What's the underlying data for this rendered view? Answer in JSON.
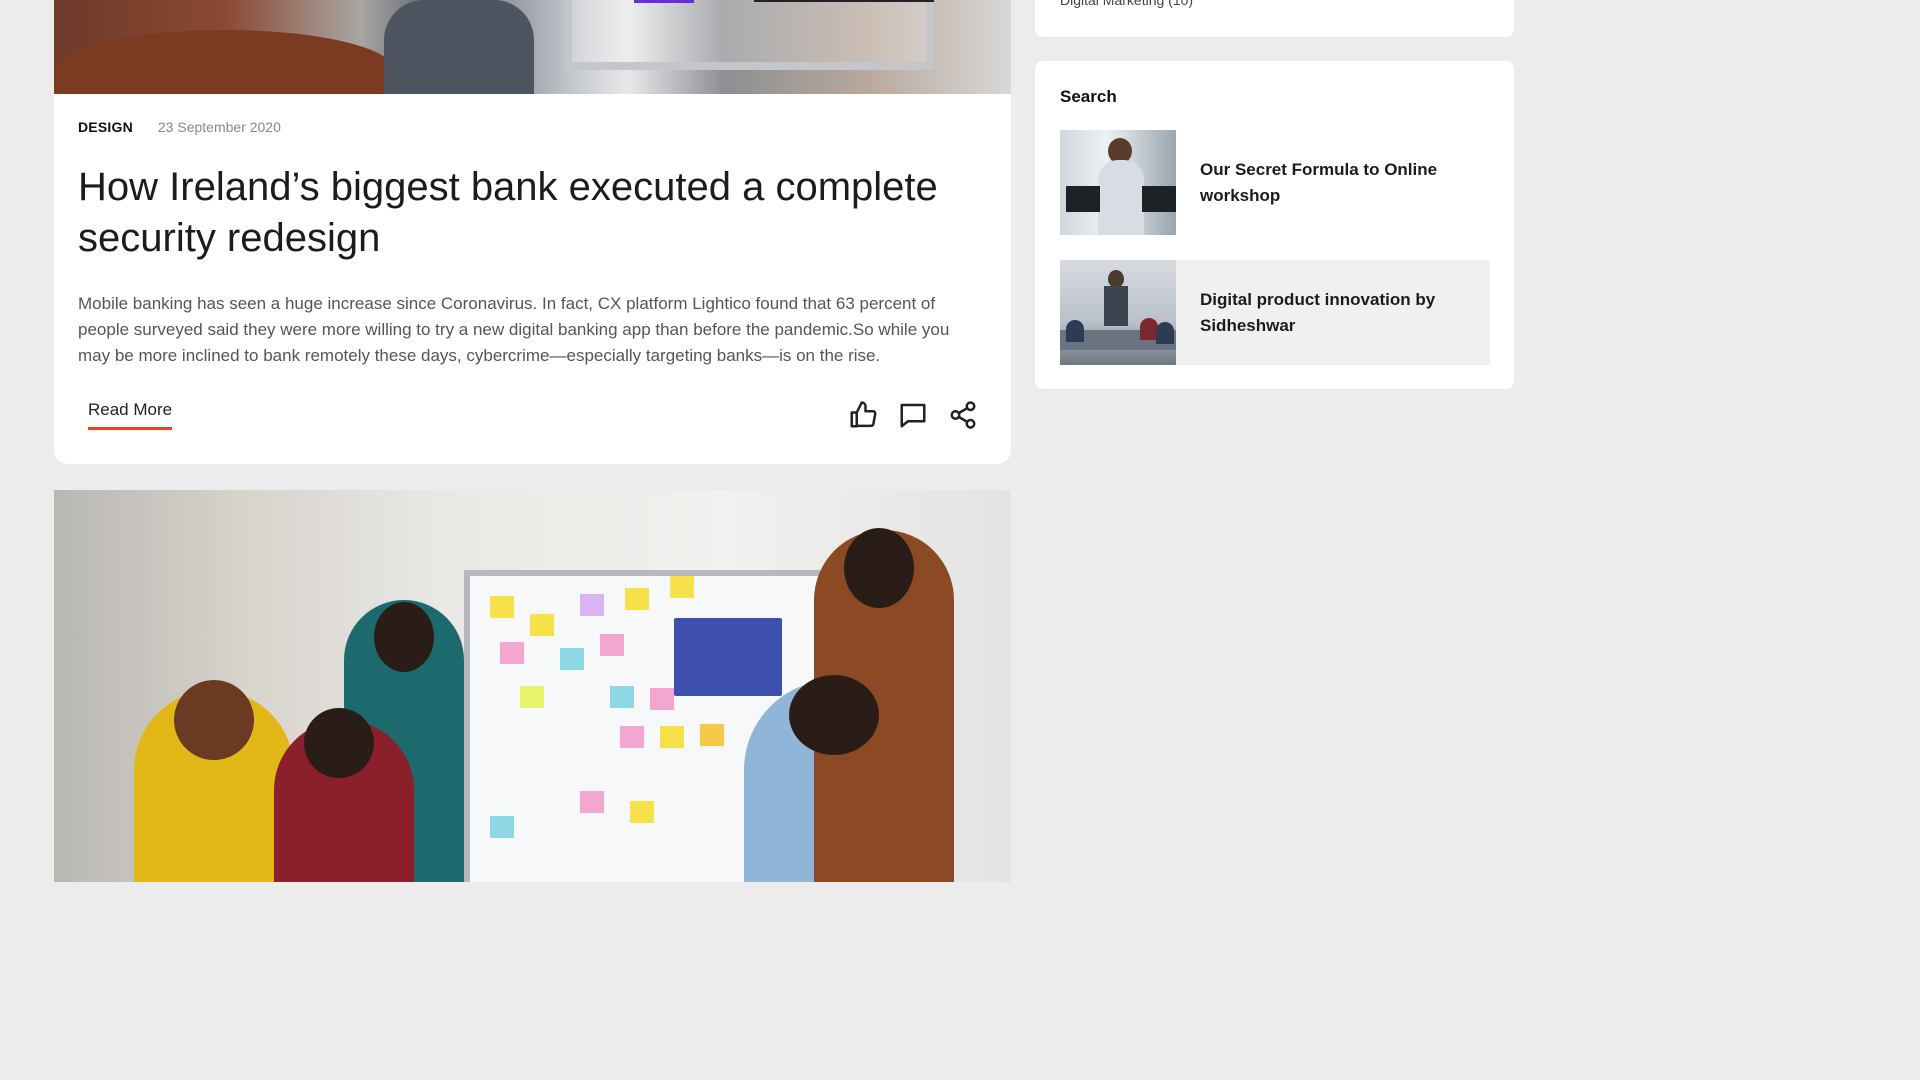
{
  "post": {
    "category": "DESIGN",
    "date": "23 September 2020",
    "title": "How Ireland’s biggest bank executed a complete security redesign",
    "excerpt": "Mobile banking has seen a huge increase since Coronavirus. In fact, CX platform Lightico found that 63 percent of people surveyed said they were more willing to try a new digital banking app than before the pandemic.So while you may be more inclined to bank remotely these days, cybercrime—especially targeting banks—is on the rise.",
    "read_more": "Read More",
    "actions": [
      "thumbs-up-icon",
      "comment-icon",
      "share-icon"
    ]
  },
  "sidebar": {
    "top_partial_text": "Digital Marketing (10)",
    "widget_title": "Search",
    "recent_posts": [
      {
        "title": "Our Secret Formula to Online workshop"
      },
      {
        "title": "Digital product innovation by Sidheshwar"
      }
    ]
  },
  "colors": {
    "accent": "#ff3b1f",
    "background": "#ececec",
    "card": "#ffffff"
  }
}
